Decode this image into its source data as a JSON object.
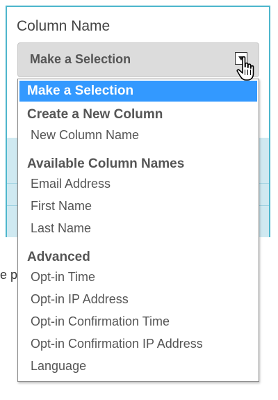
{
  "form": {
    "field_label": "Column Name",
    "select_value": "Make a Selection",
    "partial_text": "e p"
  },
  "dropdown": {
    "selected_option": "Make a Selection",
    "groups": [
      {
        "label": "Create a New Column",
        "options": [
          "New Column Name"
        ]
      },
      {
        "label": "Available Column Names",
        "options": [
          "Email Address",
          "First Name",
          "Last Name"
        ]
      },
      {
        "label": "Advanced",
        "options": [
          "Opt-in Time",
          "Opt-in IP Address",
          "Opt-in Confirmation Time",
          "Opt-in Confirmation IP Address",
          "Language"
        ]
      }
    ]
  },
  "colors": {
    "highlight": "#3399ff",
    "panel_border": "#4db6cc",
    "panel_band": "#cfe9f1"
  },
  "icons": {
    "select_arrow": "chevron-down-icon",
    "pointer": "hand-cursor-icon"
  }
}
